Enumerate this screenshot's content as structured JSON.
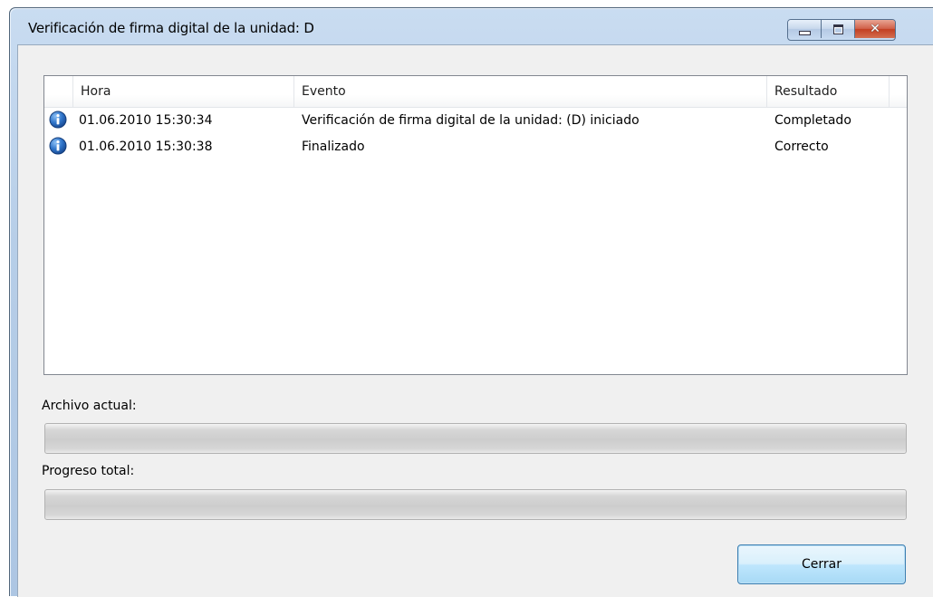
{
  "window": {
    "title": "Verificación de firma digital de la unidad: D",
    "controls": {
      "minimize_icon": "minimize-icon",
      "maximize_icon": "maximize-icon",
      "close_icon": "close-icon",
      "close_glyph": "✕"
    }
  },
  "list": {
    "columns": {
      "hora": "Hora",
      "evento": "Evento",
      "resultado": "Resultado"
    },
    "rows": [
      {
        "icon": "info-icon",
        "hora": "01.06.2010 15:30:34",
        "evento": "Verificación de firma digital de la unidad: (D) iniciado",
        "resultado": "Completado"
      },
      {
        "icon": "info-icon",
        "hora": "01.06.2010 15:30:38",
        "evento": "Finalizado",
        "resultado": "Correcto"
      }
    ]
  },
  "progress": {
    "current_label": "Archivo actual:",
    "current_value": 0,
    "total_label": "Progreso total:",
    "total_value": 0
  },
  "buttons": {
    "close_label": "Cerrar"
  },
  "colors": {
    "info_icon": "#1f5fb0",
    "button_border": "#3c7fb1",
    "close_control": "#c33f22"
  }
}
